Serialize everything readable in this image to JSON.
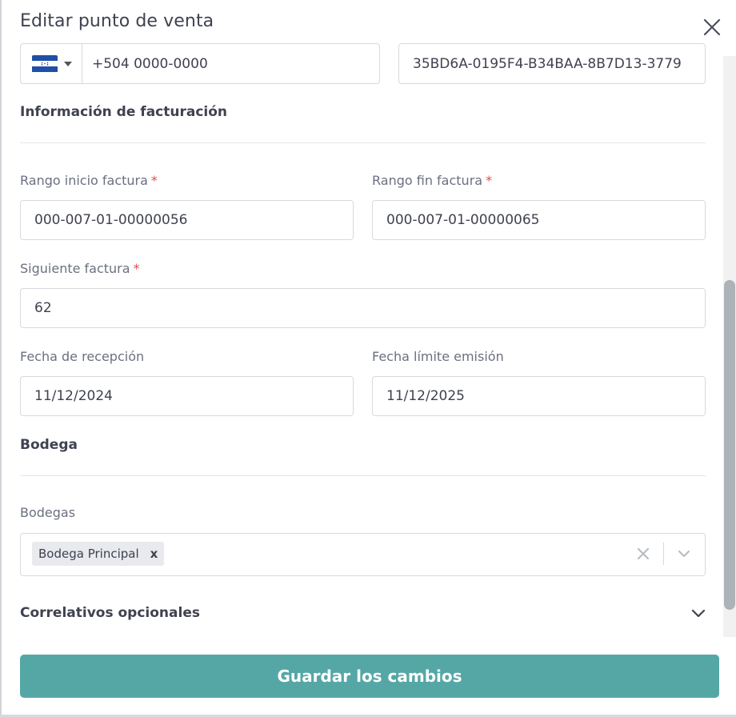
{
  "modal": {
    "title": "Editar punto de venta"
  },
  "contact": {
    "phone_value": "+504 0000-0000",
    "device_id_value": "35BD6A-0195F4-B34BAA-8B7D13-3779"
  },
  "billing": {
    "section_title": "Información de facturación",
    "range_start_label": "Rango inicio factura",
    "range_start_value": "000-007-01-00000056",
    "range_end_label": "Rango fin factura",
    "range_end_value": "000-007-01-00000065",
    "next_invoice_label": "Siguiente factura",
    "next_invoice_value": "62",
    "reception_date_label": "Fecha de recepción",
    "reception_date_value": "11/12/2024",
    "limit_date_label": "Fecha límite emisión",
    "limit_date_value": "11/12/2025",
    "required_mark": "*"
  },
  "warehouse": {
    "section_title": "Bodega",
    "field_label": "Bodegas",
    "selected": [
      "Bodega Principal"
    ],
    "chip_remove": "x"
  },
  "optional": {
    "section_title": "Correlativos opcionales"
  },
  "footer": {
    "save_label": "Guardar los cambios"
  },
  "icons": {
    "flag": "honduras-flag-icon",
    "close": "close-icon",
    "clear": "clear-icon",
    "dropdown": "chevron-down-icon"
  },
  "colors": {
    "primary": "#55a7a5",
    "required": "#e5484d",
    "flag_blue": "#1f4fa6"
  }
}
